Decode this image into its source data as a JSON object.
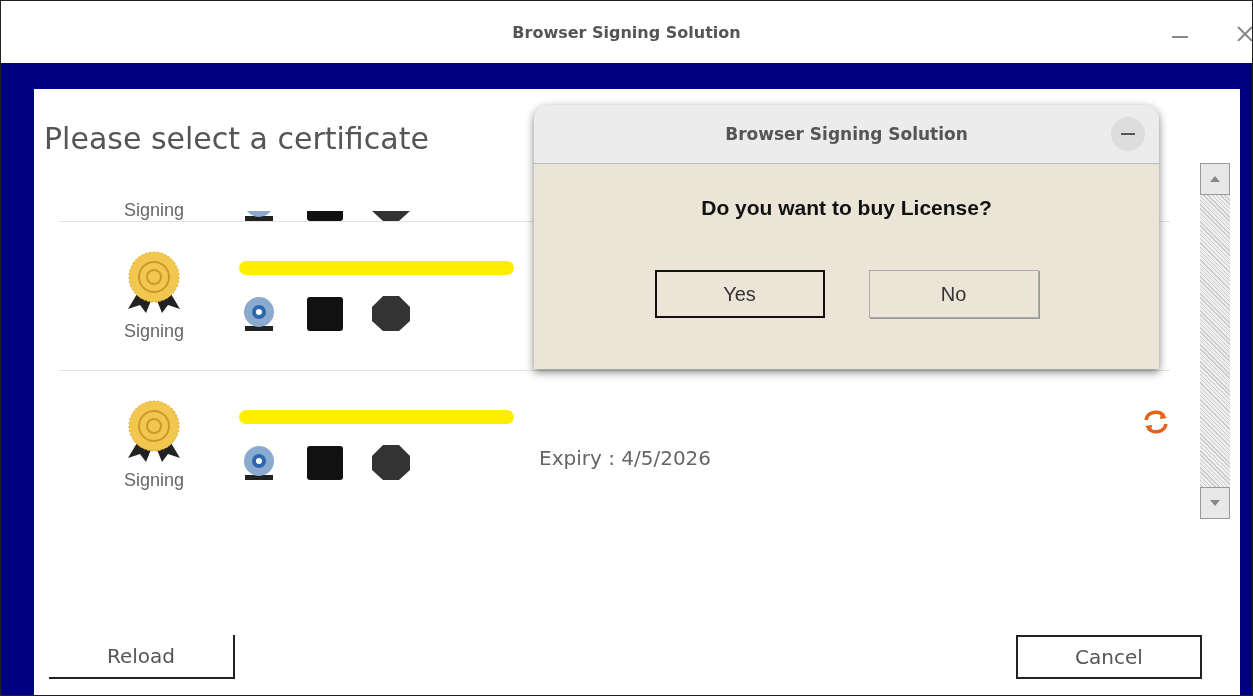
{
  "window": {
    "title": "Browser Signing Solution"
  },
  "heading": "Please select a certificate",
  "certificates": [
    {
      "kind": "partial",
      "usage": "Signing"
    },
    {
      "kind": "full",
      "usage": "Signing"
    },
    {
      "kind": "full",
      "usage": "Signing",
      "expiry": "Expiry : 4/5/2026",
      "refresh": true
    }
  ],
  "buttons": [
    {
      "label": "Reload",
      "default": false
    },
    {
      "label": "Cancel",
      "default": true
    }
  ],
  "dialog": {
    "title": "Browser Signing Solution",
    "message": "Do you want to buy License?",
    "buttons": [
      {
        "label": "Yes",
        "focused": true
      },
      {
        "label": "No",
        "focused": false
      }
    ]
  }
}
